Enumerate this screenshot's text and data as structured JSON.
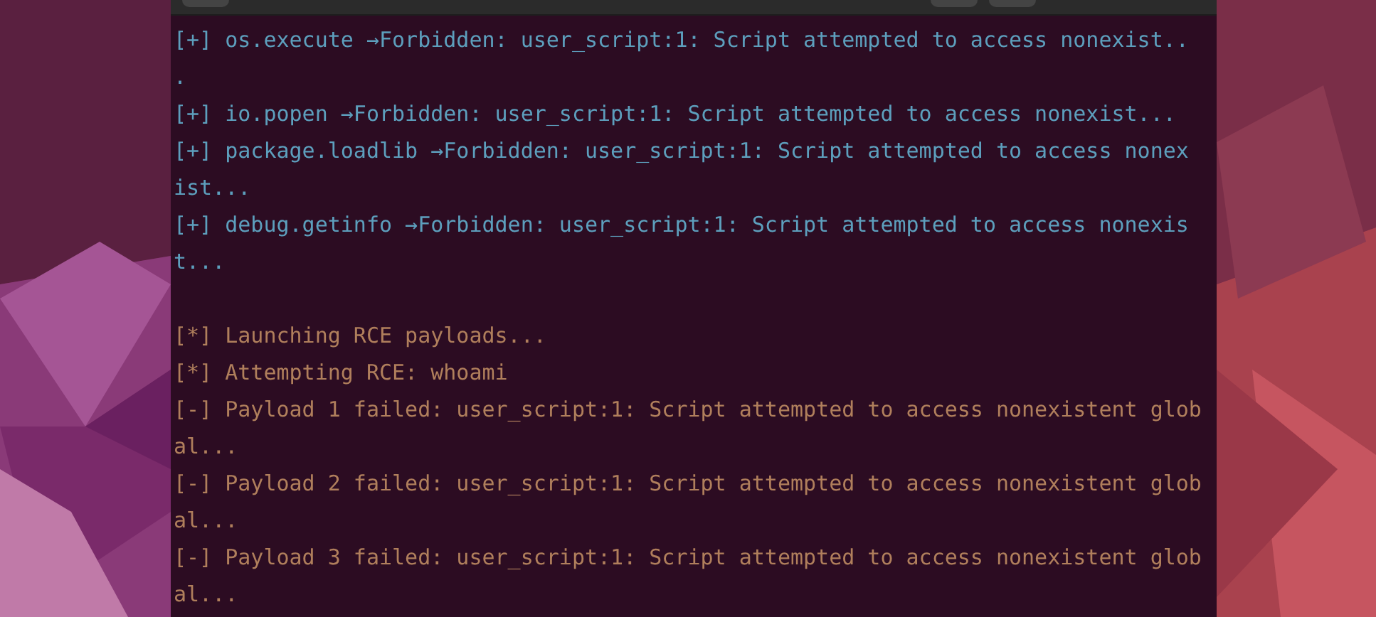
{
  "terminal": {
    "lines": [
      {
        "kind": "info",
        "text": "[+] os.execute →Forbidden: user_script:1: Script attempted to access nonexist.."
      },
      {
        "kind": "info",
        "text": "."
      },
      {
        "kind": "info",
        "text": "[+] io.popen →Forbidden: user_script:1: Script attempted to access nonexist..."
      },
      {
        "kind": "info",
        "text": "[+] package.loadlib →Forbidden: user_script:1: Script attempted to access nonex"
      },
      {
        "kind": "info",
        "text": "ist..."
      },
      {
        "kind": "info",
        "text": "[+] debug.getinfo →Forbidden: user_script:1: Script attempted to access nonexis"
      },
      {
        "kind": "info",
        "text": "t..."
      },
      {
        "kind": "blank"
      },
      {
        "kind": "status",
        "text": "[*] Launching RCE payloads..."
      },
      {
        "kind": "status",
        "text": "[*] Attempting RCE: whoami"
      },
      {
        "kind": "status",
        "text": "[-] Payload 1 failed: user_script:1: Script attempted to access nonexistent glob"
      },
      {
        "kind": "status",
        "text": "al..."
      },
      {
        "kind": "status",
        "text": "[-] Payload 2 failed: user_script:1: Script attempted to access nonexistent glob"
      },
      {
        "kind": "status",
        "text": "al..."
      },
      {
        "kind": "status",
        "text": "[-] Payload 3 failed: user_script:1: Script attempted to access nonexistent glob"
      },
      {
        "kind": "status",
        "text": "al..."
      }
    ]
  }
}
